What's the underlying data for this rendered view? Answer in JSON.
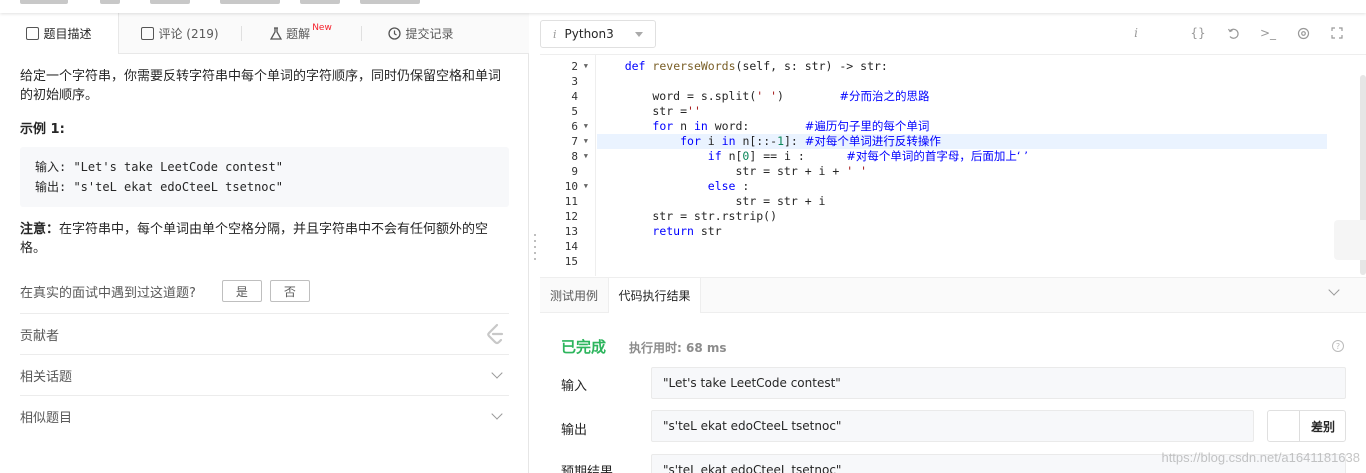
{
  "left_tabs": [
    {
      "label": "题目描述",
      "icon": "description-icon"
    },
    {
      "label": "评论 (219)",
      "icon": "comment-icon"
    },
    {
      "label": "题解",
      "badge": "New",
      "icon": "flask-icon"
    },
    {
      "label": "提交记录",
      "icon": "clock-icon"
    }
  ],
  "problem": {
    "description": "给定一个字符串，你需要反转字符串中每个单词的字符顺序，同时仍保留空格和单词的初始顺序。",
    "example_title": "示例 1:",
    "example_input": "输入: \"Let's take LeetCode contest\"",
    "example_output": "输出: \"s'teL ekat edoCteeL tsetnoc\"",
    "note_label": "注意：",
    "note_text": "在字符串中，每个单词由单个空格分隔，并且字符串中不会有任何额外的空格。",
    "interview_question": "在真实的面试中遇到过这道题?",
    "yes_label": "是",
    "no_label": "否",
    "sections": [
      "贡献者",
      "相关话题",
      "相似题目"
    ]
  },
  "editor": {
    "language": "Python3",
    "lines": [
      {
        "n": "2",
        "fold": true,
        "html": "    <span class='kw'>def</span> <span class='fn'>reverseWords</span>(self, s: str) -> str:"
      },
      {
        "n": "3",
        "fold": false,
        "html": ""
      },
      {
        "n": "4",
        "fold": false,
        "html": "        word = s.split(<span class='str'>' '</span>)        <span class='cm'>#分而治之的思路</span>"
      },
      {
        "n": "5",
        "fold": false,
        "html": "        str =<span class='str'>''</span>"
      },
      {
        "n": "6",
        "fold": true,
        "html": "        <span class='kw'>for</span> n <span class='kw'>in</span> word:        <span class='cm'>#遍历句子里的每个单词</span>"
      },
      {
        "n": "7",
        "fold": true,
        "hl": true,
        "html": "            <span class='kw'>for</span> i <span class='kw'>in</span> n[::-<span class='num-c'>1</span>]: <span class='cm'>#对每个单词进行反转操作</span>"
      },
      {
        "n": "8",
        "fold": true,
        "html": "                <span class='kw'>if</span> n[<span class='num-c'>0</span>] == i :      <span class='cm'>#对每个单词的首字母，后面加上‘ ’</span>"
      },
      {
        "n": "9",
        "fold": false,
        "html": "                    str = str + i + <span class='str'>' '</span>"
      },
      {
        "n": "10",
        "fold": true,
        "html": "                <span class='kw'>else</span> :"
      },
      {
        "n": "11",
        "fold": false,
        "html": "                    str = str + i"
      },
      {
        "n": "12",
        "fold": false,
        "html": "        str = str.rstrip()"
      },
      {
        "n": "13",
        "fold": false,
        "html": "        <span class='kw'>return</span> str"
      },
      {
        "n": "14",
        "fold": false,
        "html": ""
      },
      {
        "n": "15",
        "fold": false,
        "html": ""
      }
    ]
  },
  "result_tabs": [
    "测试用例",
    "代码执行结果"
  ],
  "result": {
    "status": "已完成",
    "runtime": "执行用时: 68 ms",
    "input_label": "输入",
    "input_value": "\"Let's take LeetCode contest\"",
    "output_label": "输出",
    "output_value": "\"s'teL ekat edoCteeL tsetnoc\"",
    "diff_label": "差别",
    "expected_label": "预期结果",
    "expected_value": "\"s'teL ekat edoCteeL tsetnoc\""
  },
  "watermark": "https://blog.csdn.net/a1641181638"
}
